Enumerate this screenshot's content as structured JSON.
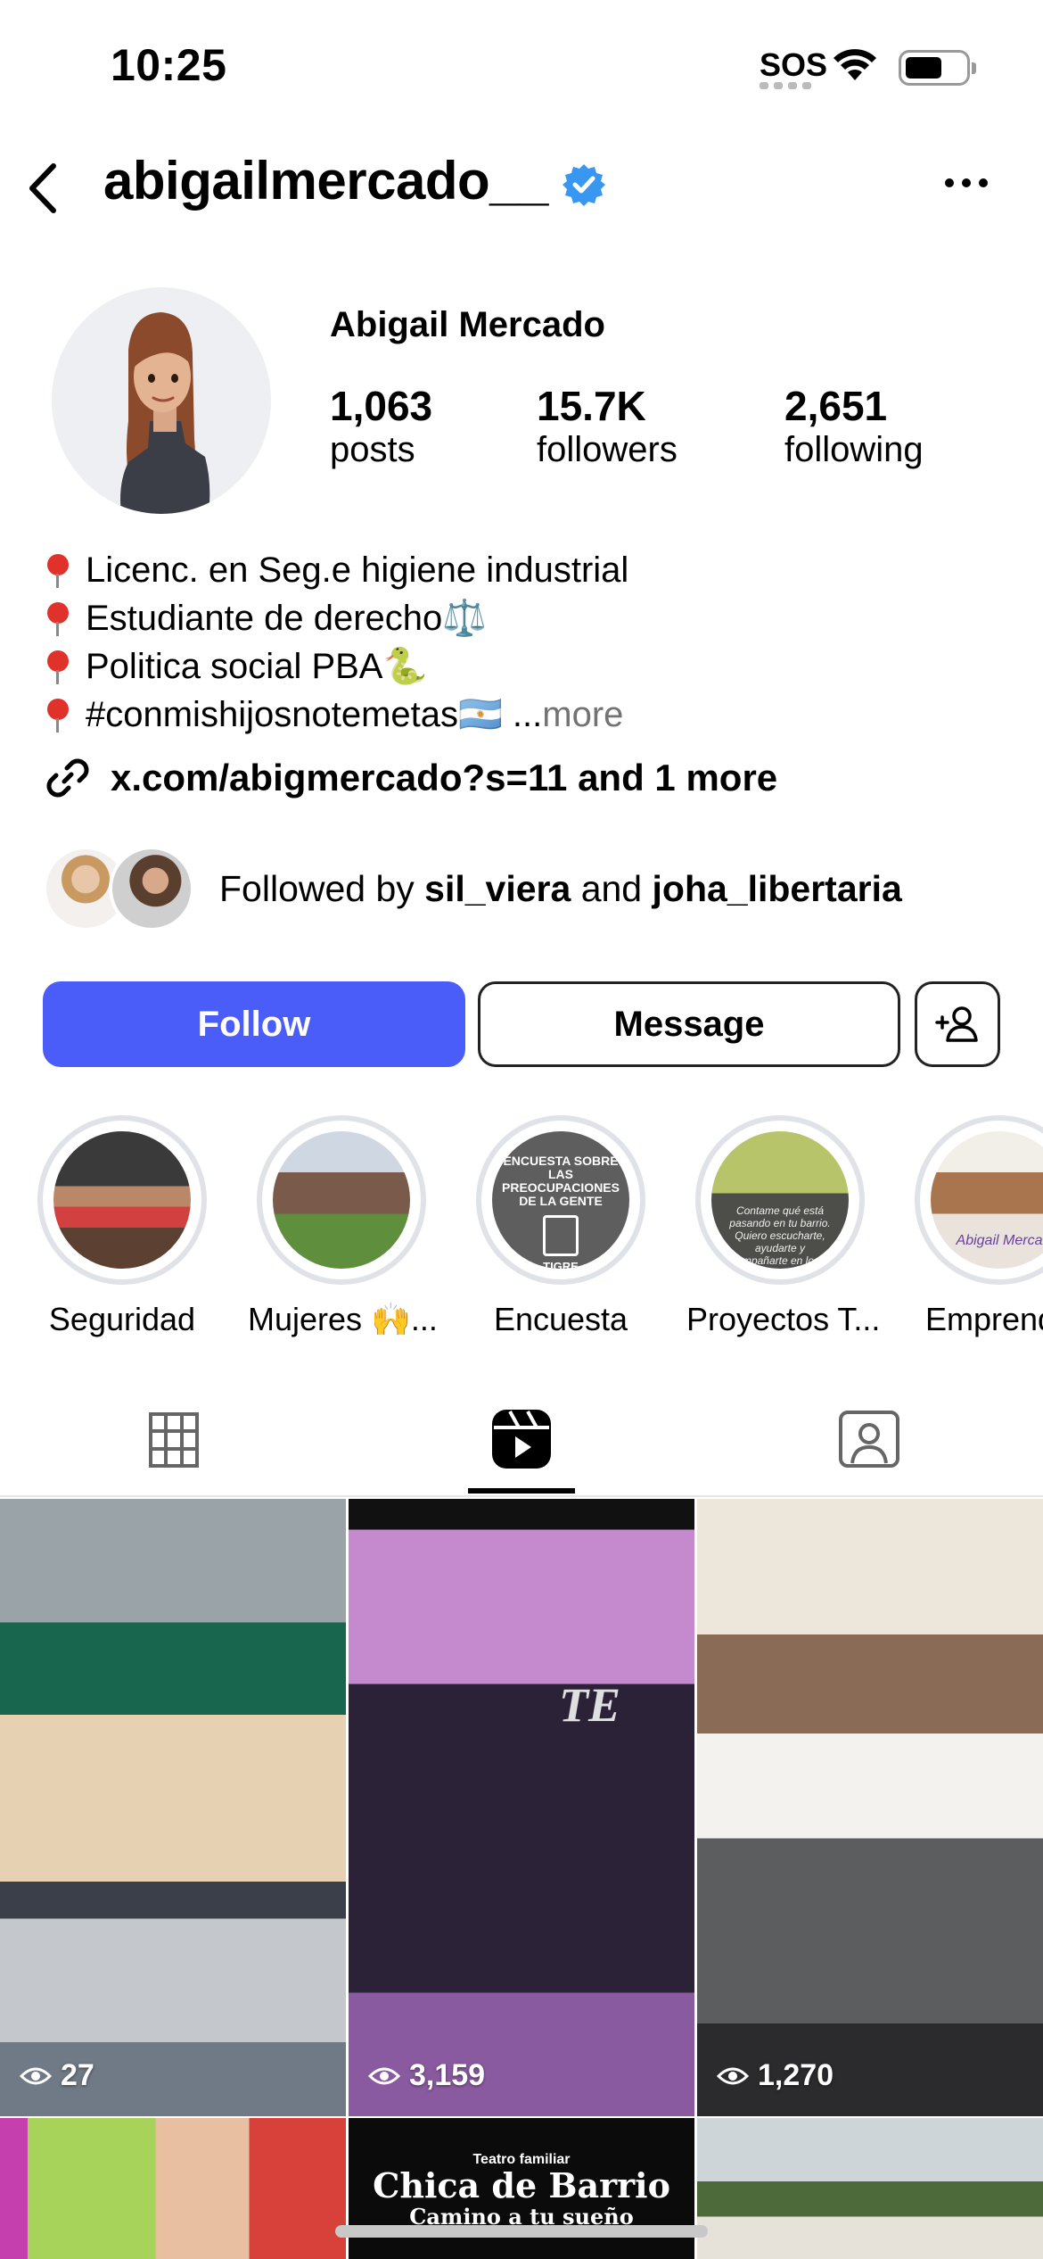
{
  "status_bar": {
    "time": "10:25",
    "sos": "SOS"
  },
  "header": {
    "username": "abigailmercado__"
  },
  "profile": {
    "full_name": "Abigail Mercado",
    "stats": [
      {
        "value": "1,063",
        "label": "posts"
      },
      {
        "value": "15.7K",
        "label": "followers"
      },
      {
        "value": "2,651",
        "label": "following"
      }
    ],
    "bio": [
      "Licenc. en Seg.e higiene industrial",
      "Estudiante de derecho⚖️",
      "Politica social PBA🐍",
      "#conmishijosnotemetas🇦🇷 ..."
    ],
    "bio_more": " more",
    "link": "x.com/abigmercado?s=11 and 1 more",
    "followed_prefix": "Followed by ",
    "followed_user1": "sil_viera",
    "followed_and": " and ",
    "followed_user2": "joha_libertaria"
  },
  "buttons": {
    "follow": "Follow",
    "message": "Message"
  },
  "highlights": [
    {
      "label": "Seguridad"
    },
    {
      "label": "Mujeres 🙌..."
    },
    {
      "label": "Encuesta",
      "cover_text": "ENCUESTA SOBRE LAS PREOCUPACIONES DE LA GENTE",
      "cover_sub": "TIGRE"
    },
    {
      "label": "Proyectos T...",
      "cover_text": "Contame qué está pasando en tu barrio. Quiero escucharte, ayudarte y acompañarte en lo que más te"
    },
    {
      "label": "Emprende",
      "cover_text": "Abigail Merca"
    }
  ],
  "tabs": [
    "grid",
    "reels",
    "tagged"
  ],
  "active_tab": "reels",
  "reels": [
    {
      "views": "27"
    },
    {
      "views": "3,159",
      "overlay_text": "TE"
    },
    {
      "views": "1,270"
    },
    {
      "views": ""
    },
    {
      "views": "",
      "title_small": "Teatro familiar",
      "title": "Chica de Barrio",
      "subtitle": "Camino a tu sueño"
    },
    {
      "views": ""
    }
  ]
}
